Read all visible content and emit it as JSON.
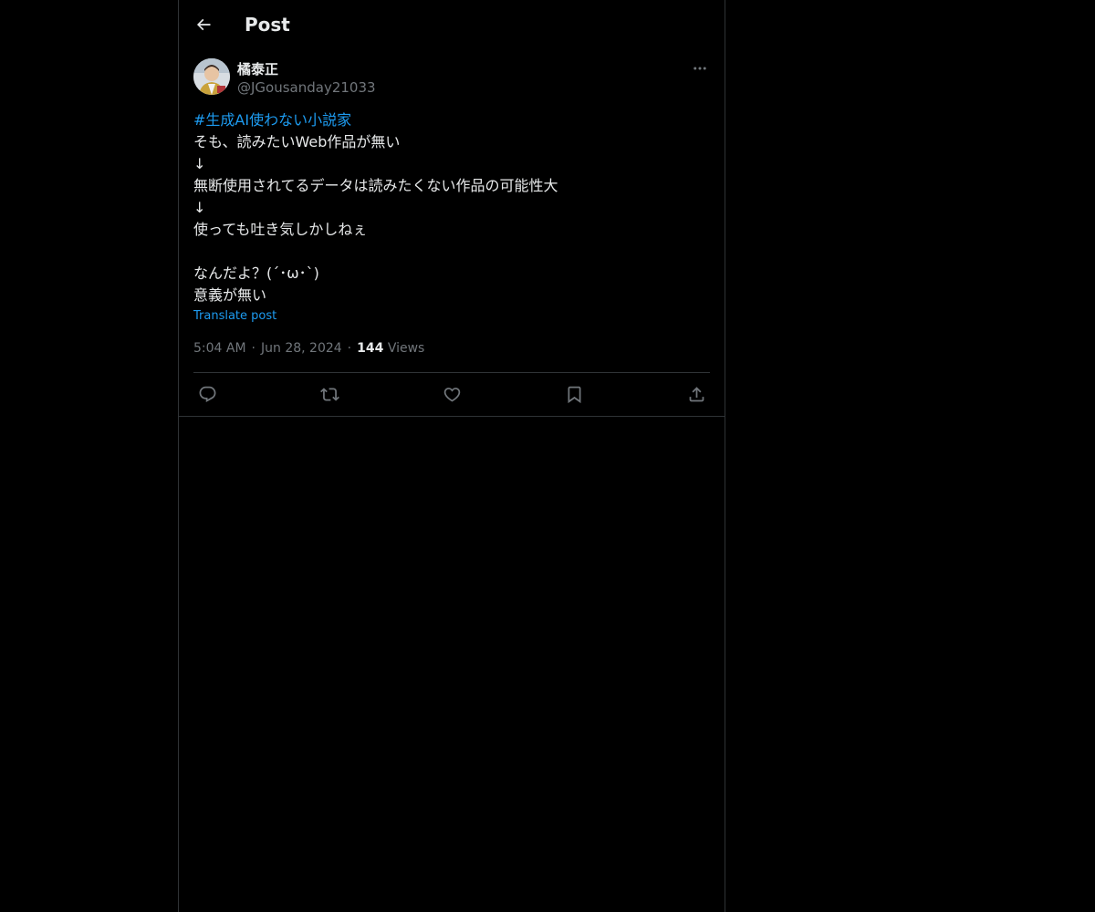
{
  "header": {
    "title": "Post",
    "back_icon": "arrow-left-icon"
  },
  "post": {
    "author": {
      "display_name": "橘泰正",
      "handle": "@JGousanday21033",
      "avatar_icon": "avatar"
    },
    "more_icon": "more-dots-icon",
    "hashtag": "#生成AI使わない小説家",
    "lines": [
      "そも、読みたいWeb作品が無い",
      "↓",
      "無断使用されてるデータは読みたくない作品の可能性大",
      "↓",
      "使っても吐き気しかしねぇ",
      "",
      "なんだよ？(´･ω･`)",
      "意義が無い"
    ],
    "translate_label": "Translate post",
    "time": "5:04 AM",
    "date": "Jun 28, 2024",
    "separator": "·",
    "views_count": "144",
    "views_label": "Views"
  },
  "actions": [
    {
      "icon": "reply-icon"
    },
    {
      "icon": "repost-icon"
    },
    {
      "icon": "like-icon"
    },
    {
      "icon": "bookmark-icon"
    },
    {
      "icon": "share-icon"
    }
  ],
  "colors": {
    "background": "#000000",
    "text": "#e7e9ea",
    "secondary": "#71767b",
    "accent": "#1d9bf0",
    "border": "#2f3336"
  }
}
